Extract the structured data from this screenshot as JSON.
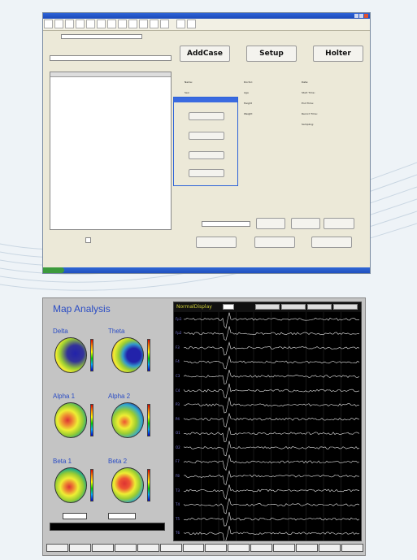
{
  "app": {
    "buttons": {
      "addcase": "AddCase",
      "setup": "Setup",
      "holter": "Holter"
    },
    "patient_fields_left": [
      "Name:",
      "Sex:"
    ],
    "patient_fields_mid": [
      "Doctor:",
      "Age",
      "Height",
      "Weight"
    ],
    "patient_fields_right": [
      "Date:",
      "Start Time:",
      "End Time:",
      "Record Time:",
      "Sampling:"
    ],
    "dialog_buttons": [
      "",
      "",
      "",
      ""
    ],
    "bottom_buttons": [
      "",
      "",
      ""
    ],
    "lower_buttons": [
      "",
      "",
      ""
    ],
    "left_red_labels": [
      "",
      ""
    ]
  },
  "map": {
    "title": "Map Analysis",
    "bands": [
      {
        "label": "Delta"
      },
      {
        "label": "Theta"
      },
      {
        "label": "Alpha 1"
      },
      {
        "label": "Alpha 2"
      },
      {
        "label": "Beta 1"
      },
      {
        "label": "Beta 2"
      }
    ],
    "head_buttons": [
      "",
      ""
    ]
  },
  "eeg": {
    "title": "NormalDisplay",
    "channels": [
      "Fp1",
      "Fp2",
      "F3",
      "F4",
      "C3",
      "C4",
      "P3",
      "P4",
      "O1",
      "O2",
      "F7",
      "F8",
      "T3",
      "T4",
      "T5",
      "T6"
    ],
    "tabs": [
      "",
      "",
      "",
      ""
    ],
    "bottom_tabs": [
      "",
      "",
      "",
      "",
      "",
      "",
      "",
      "",
      "",
      "",
      "",
      "",
      "",
      ""
    ]
  },
  "colors": {
    "accent_blue": "#2a4cc4",
    "eeg_bg": "#000000",
    "eeg_trace": "#e8e8e8",
    "xp_title": "#2d63d8"
  }
}
